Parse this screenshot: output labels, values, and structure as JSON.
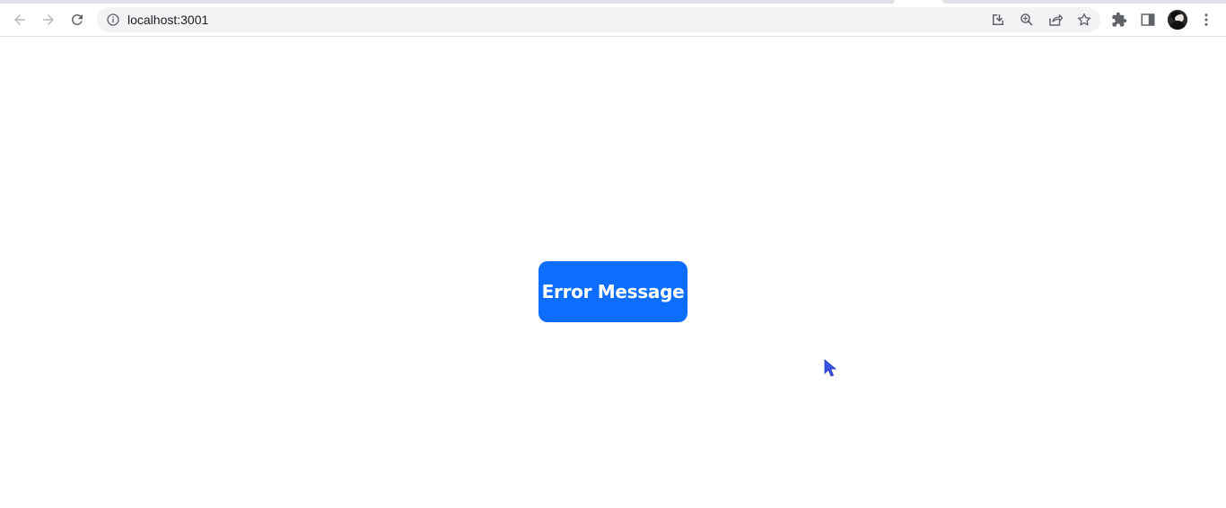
{
  "browser": {
    "url": "localhost:3001",
    "icons": {
      "back": "arrow-left-icon",
      "forward": "arrow-right-icon",
      "reload": "reload-icon",
      "site_info": "info-icon",
      "install": "install-icon",
      "zoom": "zoom-icon",
      "share": "share-icon",
      "bookmark": "star-icon",
      "extensions": "puzzle-icon",
      "side_panel": "side-panel-icon",
      "menu": "kebab-menu-icon"
    }
  },
  "page": {
    "button_label": "Error Message"
  },
  "colors": {
    "button_bg": "#0d6efd",
    "button_text": "#ffffff",
    "omnibox_bg": "#f1f3f4"
  }
}
